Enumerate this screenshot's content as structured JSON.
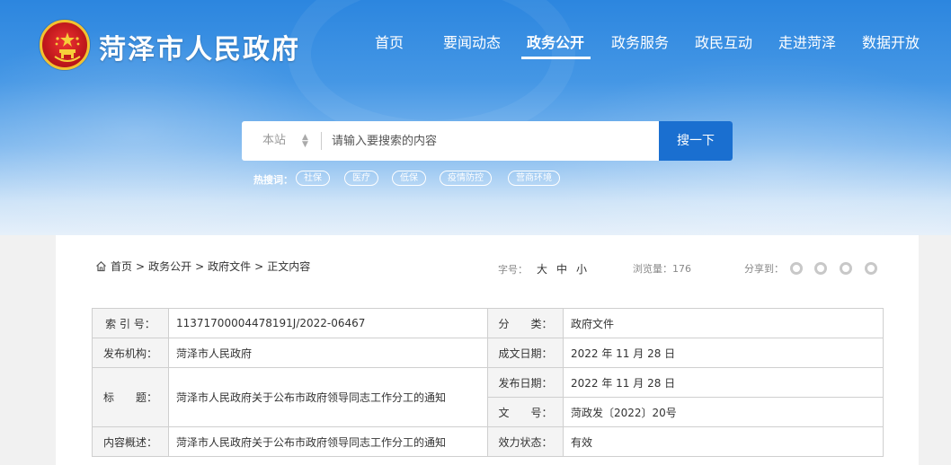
{
  "site": {
    "title": "菏泽市人民政府"
  },
  "nav": [
    {
      "label": "首页",
      "active": false
    },
    {
      "label": "要闻动态",
      "active": false
    },
    {
      "label": "政务公开",
      "active": true
    },
    {
      "label": "政务服务",
      "active": false
    },
    {
      "label": "政民互动",
      "active": false
    },
    {
      "label": "走进菏泽",
      "active": false
    },
    {
      "label": "数据开放",
      "active": false
    }
  ],
  "search": {
    "scope": "本站",
    "placeholder": "请输入要搜索的内容",
    "button": "搜一下",
    "hot_label": "热搜词：",
    "hot_words": [
      "社保",
      "医疗",
      "低保",
      "疫情防控",
      "营商环境"
    ]
  },
  "breadcrumb": [
    "首页",
    "政务公开",
    "政府文件",
    "正文内容"
  ],
  "tools": {
    "font_size_label": "字号：",
    "font_sizes": [
      "大",
      "中",
      "小"
    ],
    "views": "浏览量：176",
    "share_label": "分享到："
  },
  "info": {
    "index_label": "索 引 号：",
    "index_value": "11371700004478191J/2022-06467",
    "category_label": "分　　类：",
    "category_value": "政府文件",
    "publisher_label": "发布机构：",
    "publisher_value": "菏泽市人民政府",
    "created_label": "成文日期：",
    "created_value": "2022 年 11 月 28 日",
    "title_label": "标　　题：",
    "title_value": "菏泽市人民政府关于公布市政府领导同志工作分工的通知",
    "published_label": "发布日期：",
    "published_value": "2022 年 11 月 28 日",
    "docno_label": "文　　号：",
    "docno_value": "菏政发〔2022〕20号",
    "summary_label": "内容概述：",
    "summary_value": "菏泽市人民政府关于公布市政府领导同志工作分工的通知",
    "status_label": "效力状态：",
    "status_value": "有效"
  }
}
